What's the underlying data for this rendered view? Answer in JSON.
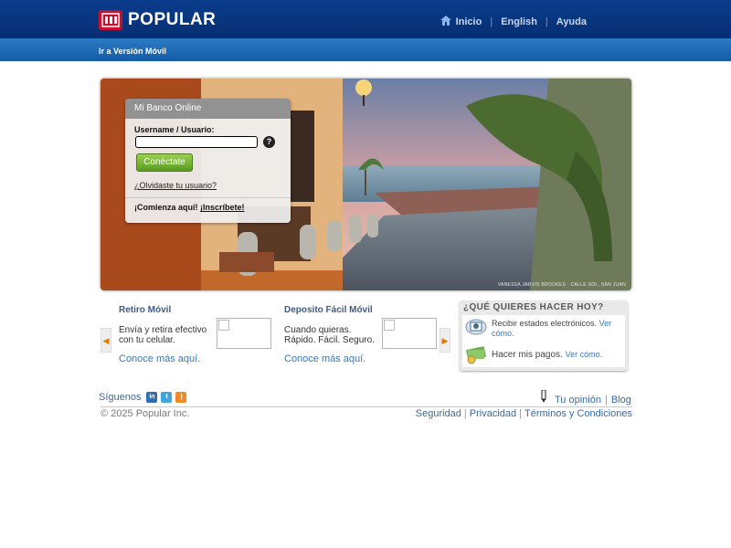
{
  "brand": {
    "name": "POPULAR"
  },
  "topnav": {
    "home": "Inicio",
    "english": "English",
    "help": "Ayuda"
  },
  "subbar": {
    "mobile_link": "Ir a Versión Móvil"
  },
  "hero": {
    "credit": "VANESSA JARVIS BROOKES · CALLE SOL, SAN JUAN"
  },
  "login": {
    "title": "Mi Banco Online",
    "label": "Username / Usuario:",
    "value": "",
    "button": "Conéctate",
    "forgot": "¿Olvidaste tu usuario?",
    "signup_prefix": "¡Comienza aquí!",
    "signup_link": "¡Inscríbete!"
  },
  "promos": [
    {
      "title": "Retiro Móvil",
      "desc": "Envía y retira efectivo\ncon tu celular.",
      "link": "Conoce más aquí."
    },
    {
      "title": "Deposito Fácil Móvil",
      "desc": "Cuando quieras.\nRápido. Fácil. Seguro.",
      "link": "Conoce más aquí."
    }
  ],
  "quick": {
    "title": "¿QUÉ QUIERES HACER HOY?",
    "items": [
      {
        "text": "Recibir estados electrónicos.",
        "link": "Ver cómo."
      },
      {
        "text": "Hacer mis pagos.",
        "link": "Ver cómo."
      }
    ]
  },
  "footer": {
    "follow": "Síguenos",
    "social_icons": [
      "linkedin-icon",
      "twitter-icon",
      "rss-icon"
    ],
    "opinion": "Tu opinión",
    "blog": "Blog",
    "copyright": "© 2025 Popular Inc.",
    "legal": [
      "Seguridad",
      "Privacidad",
      "Términos y Condiciones"
    ]
  },
  "colors": {
    "top_bar": "#0a3c8c",
    "sub_bar": "#1f6cb5",
    "button_green": "#6eae2f",
    "link": "#3a77b5"
  }
}
